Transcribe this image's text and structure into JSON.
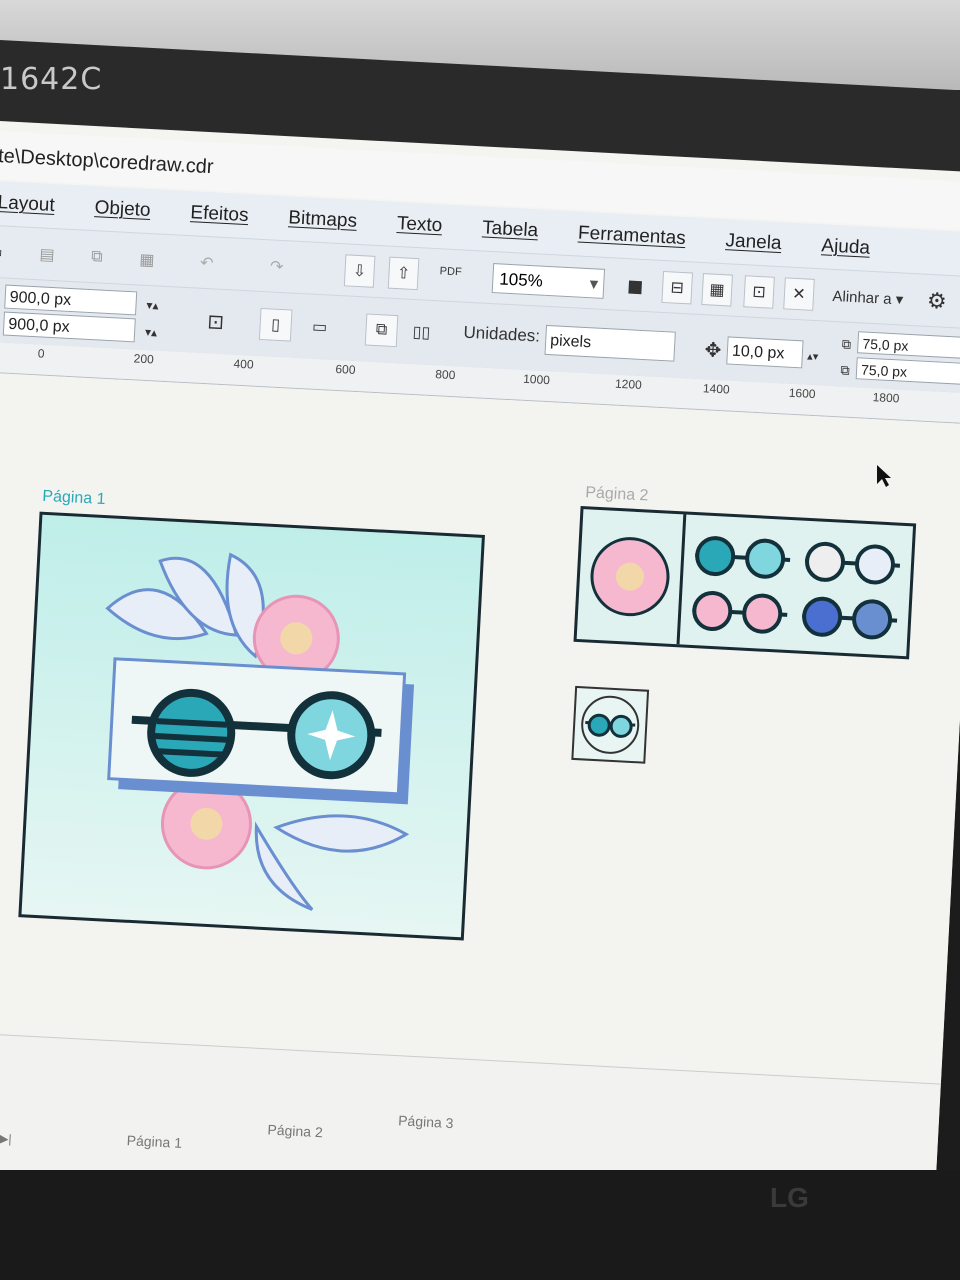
{
  "monitor": {
    "model": "1642C",
    "brand": "LG"
  },
  "window": {
    "title": "te\\Desktop\\coredraw.cdr"
  },
  "menu": [
    "Layout",
    "Objeto",
    "Efeitos",
    "Bitmaps",
    "Texto",
    "Tabela",
    "Ferramentas",
    "Janela",
    "Ajuda"
  ],
  "toolbar": {
    "zoom": "105%",
    "pdf_label": "PDF",
    "align_label": "Alinhar a"
  },
  "propbar": {
    "width": "900,0 px",
    "height": "900,0 px",
    "units_label": "Unidades:",
    "units_value": "pixels",
    "nudge": "10,0 px",
    "dup_x": "75,0 px",
    "dup_y": "75,0 px"
  },
  "ruler": [
    "0",
    "200",
    "400",
    "600",
    "800",
    "1000",
    "1200",
    "1400",
    "1600",
    "1800"
  ],
  "pages": {
    "p1": "Página 1",
    "p2": "Página 2",
    "p3": "Página 3"
  },
  "colors": {
    "accent": "#2aa8b8",
    "pink": "#f0b4cf",
    "mint": "#c8f0ea",
    "blue": "#4a6fd0"
  }
}
